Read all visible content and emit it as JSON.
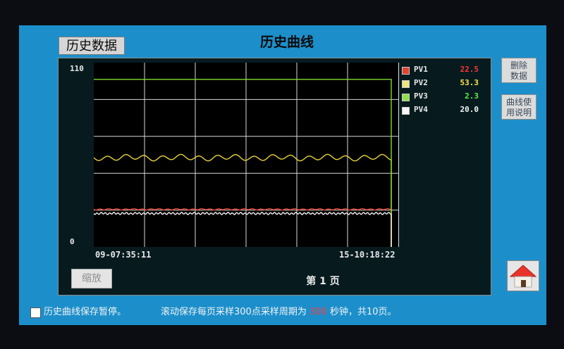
{
  "header": {
    "history_data_label": "历史数据",
    "title": "历史曲线"
  },
  "plot": {
    "y_max_label": "110",
    "y_min_label": "0",
    "time_start": "09-07:35:11",
    "time_end": "15-10:18:22"
  },
  "chart_data": {
    "type": "line",
    "ylim": [
      0,
      110
    ],
    "grid": true,
    "series": [
      {
        "name": "PV1",
        "color": "#e5432e",
        "level": 22.5,
        "amplitude": 0.3,
        "period": 12
      },
      {
        "name": "PV2",
        "color": "#e8d33a",
        "level": 53.3,
        "amplitude": 1.4,
        "period": 26
      },
      {
        "name": "PV3",
        "color": "#7edb2e",
        "level": 100,
        "amplitude": 0,
        "period": 0
      },
      {
        "name": "PV4",
        "color": "#f2f2f2",
        "level": 20.0,
        "amplitude": 0.5,
        "period": 6
      }
    ]
  },
  "legend": [
    {
      "name": "PV1",
      "value": "22.5",
      "color": "#e5432e",
      "value_color": "#ff3636"
    },
    {
      "name": "PV2",
      "value": "53.3",
      "color": "#ece77f",
      "value_color": "#ffe34a"
    },
    {
      "name": "PV3",
      "value": "2.3",
      "color": "#8fe04a",
      "value_color": "#5ef04e"
    },
    {
      "name": "PV4",
      "value": "20.0",
      "color": "#f5f5f5",
      "value_color": "#f5f5f5"
    }
  ],
  "buttons": {
    "delete_line1": "删除",
    "delete_line2": "数据",
    "help_line1": "曲线使",
    "help_line2": "用说明",
    "zoom": "缩放"
  },
  "pagination": {
    "page_label": "第 1 页"
  },
  "status": {
    "pause_label": "历史曲线保存暂停。",
    "scroll_prefix": "滚动保存每页采样300点采样周期为",
    "period_value": "300",
    "scroll_suffix": "秒钟，共10页。"
  }
}
